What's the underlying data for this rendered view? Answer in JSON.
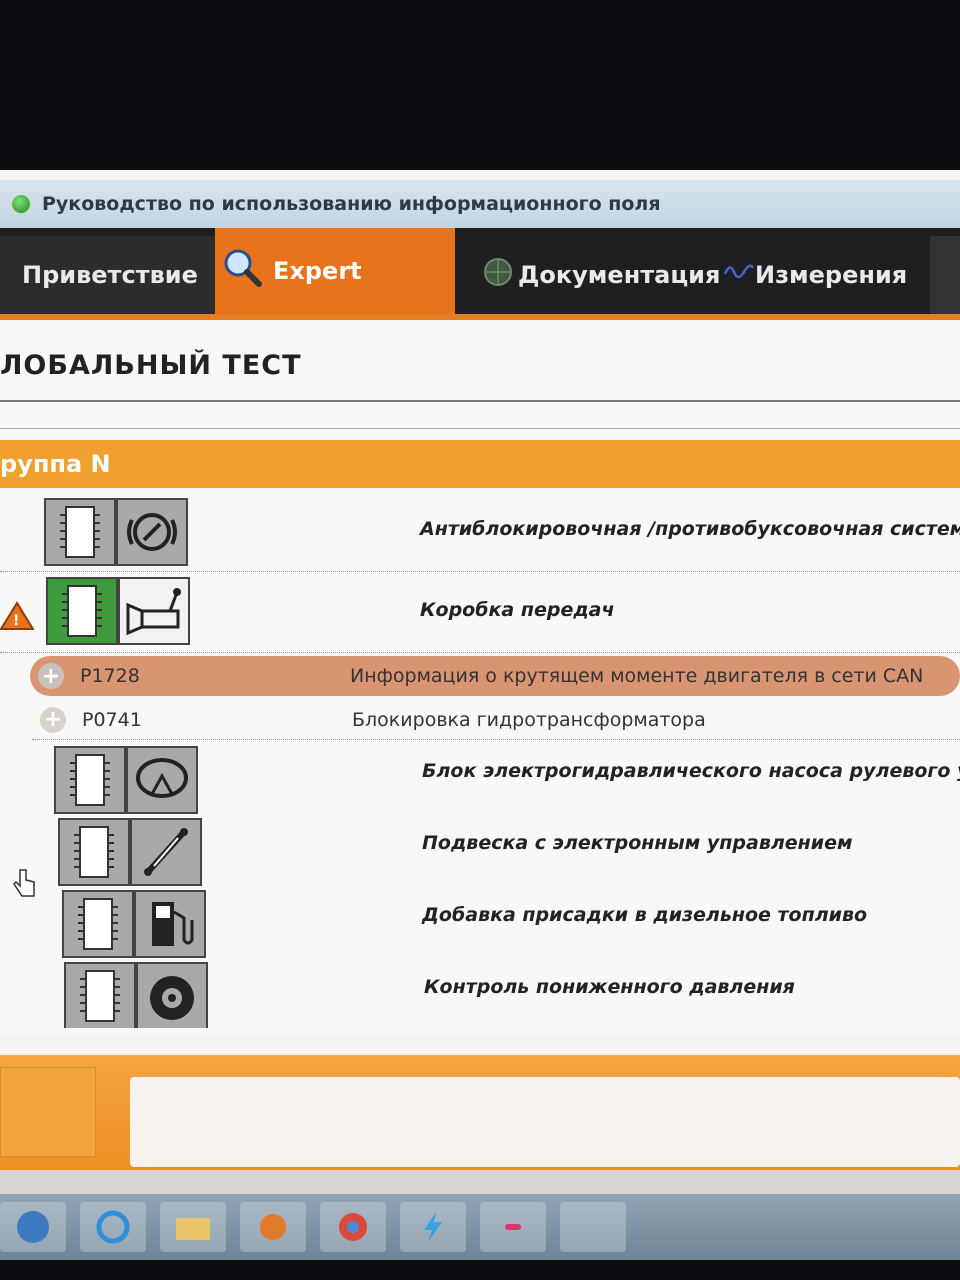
{
  "window": {
    "title": "Руководство по использованию информационного поля"
  },
  "tabs": [
    {
      "label": "Приветствие"
    },
    {
      "label": "Expert"
    },
    {
      "label": "Документация"
    },
    {
      "label": "Измерения"
    }
  ],
  "content": {
    "page_title": "ЛОБАЛЬНЫЙ ТЕСТ",
    "group_header": "руппа N",
    "modules": [
      {
        "label": "Антиблокировочная /противобуксовочная система кол",
        "icon": "abs-icon"
      },
      {
        "label": "Коробка передач",
        "icon": "gearbox-icon"
      },
      {
        "label": "Блок электрогидравлического насоса рулевого усилите",
        "icon": "steering-icon"
      },
      {
        "label": "Подвеска с электронным управлением",
        "icon": "suspension-icon"
      },
      {
        "label": "Добавка присадки в дизельное топливо",
        "icon": "fuel-pump-icon"
      },
      {
        "label": "Контроль пониженного давления",
        "icon": "tire-icon"
      }
    ],
    "faults": [
      {
        "code": "P1728",
        "description": "Информация о крутящем моменте двигателя в сети CAN",
        "selected": true
      },
      {
        "code": "P0741",
        "description": "Блокировка гидротрансформатора",
        "selected": false
      }
    ]
  },
  "colors": {
    "accent": "#e8731c",
    "group_header": "#f0a02e",
    "selected_row": "#d99572"
  }
}
